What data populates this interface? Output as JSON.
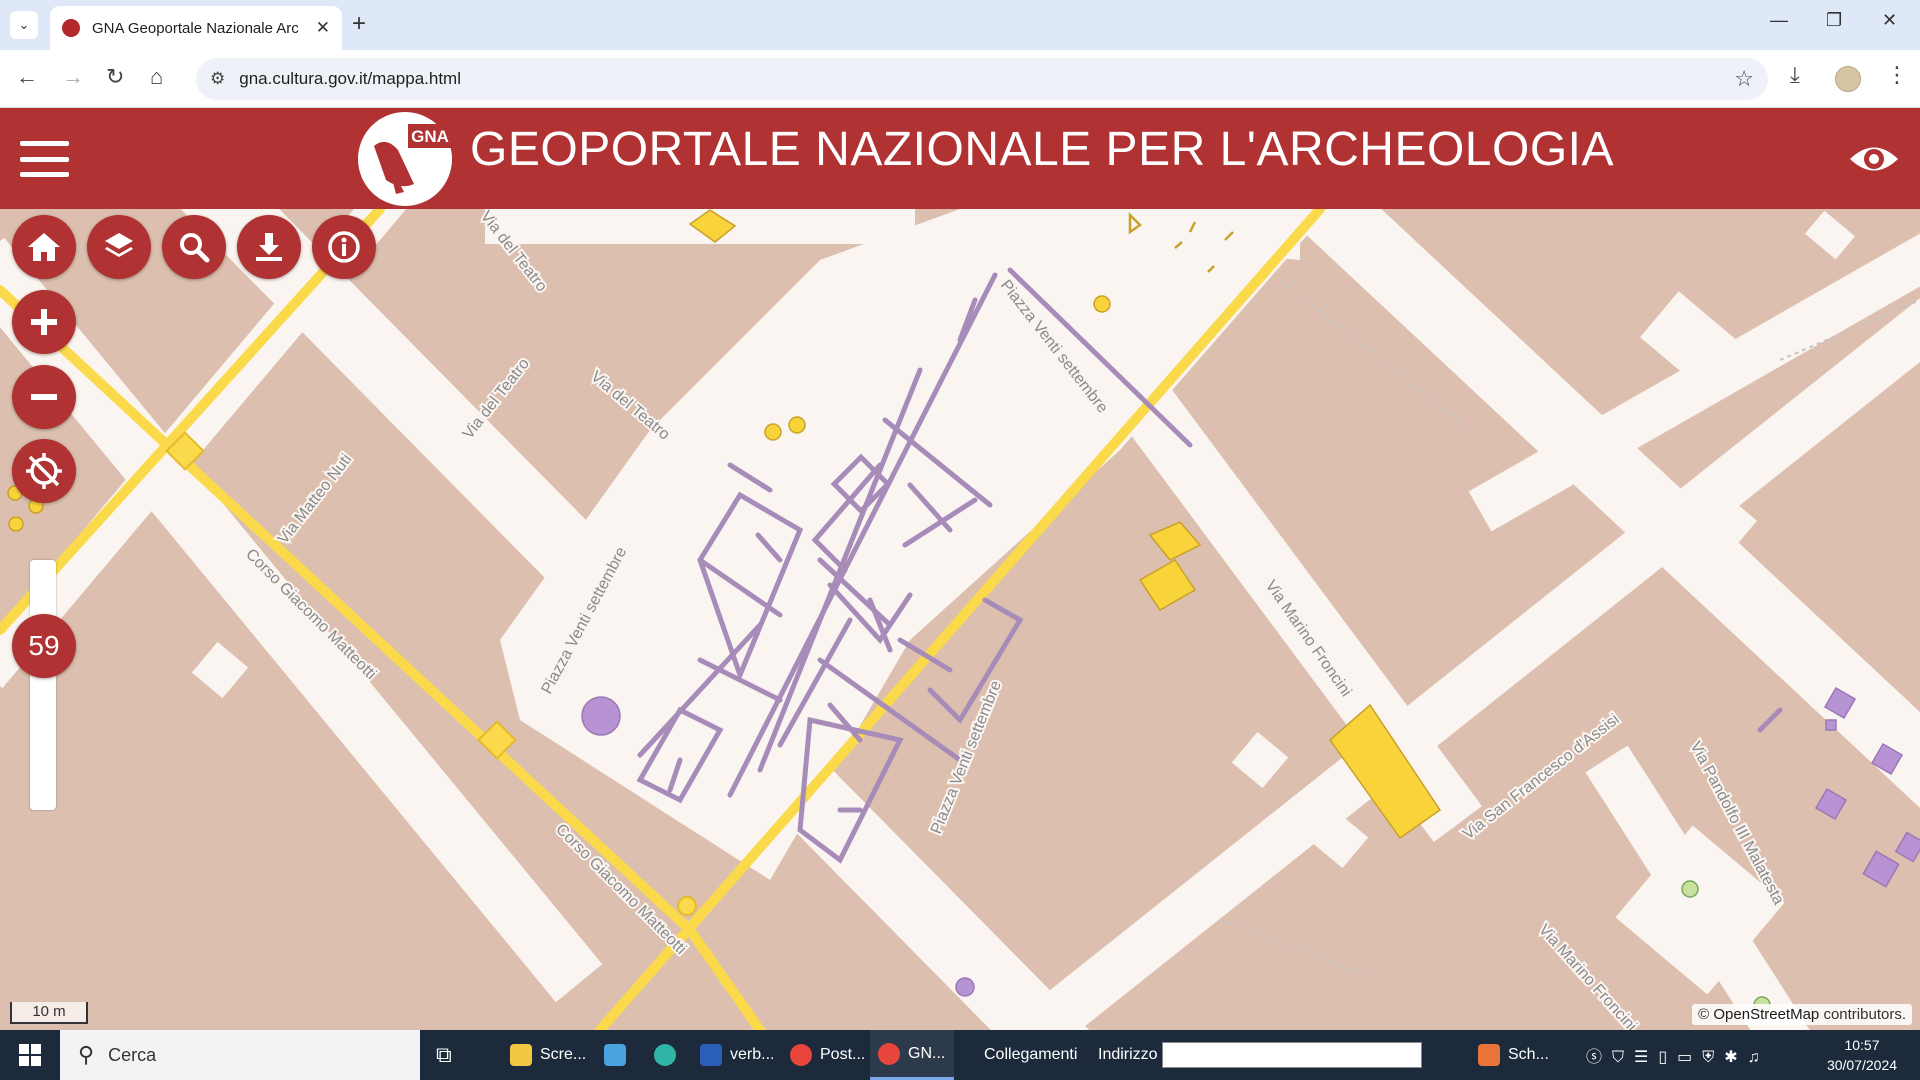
{
  "browser": {
    "tab_title": "GNA Geoportale Nazionale Arc",
    "url": "gna.cultura.gov.it/mappa.html",
    "icons": [
      "tab-list-icon",
      "close-icon",
      "plus-icon",
      "minimize-icon",
      "restore-icon",
      "back-icon",
      "forward-icon",
      "reload-icon",
      "home-icon",
      "site-info-icon",
      "star-icon",
      "download-icon",
      "menu-dots-icon"
    ]
  },
  "app": {
    "logo_text": "GNA",
    "title": "GEOPORTALE NAZIONALE PER L'ARCHEOLOGIA",
    "colors": {
      "header": "#b03233",
      "controls": "#b03233",
      "buildings": "#dcbfae",
      "roads": "#fbf5f1",
      "main_roads": "#fada4a",
      "features_purple": "#a78bb9",
      "features_yellow": "#f8d33a"
    }
  },
  "map": {
    "zoom_level": "59",
    "scale_label": "10 m",
    "attribution_prefix": "©",
    "attribution_link": "OpenStreetMap",
    "attribution_suffix": "contributors.",
    "street_labels": {
      "via_del_teatro_1": "Via del Teatro",
      "via_del_teatro_2": "Via del Teatro",
      "via_del_teatro_3": "Via del Teatro",
      "via_matteo_nuti": "Via Matteo Nuti",
      "corso_matteotti_1": "Corso Giacomo Matteotti",
      "corso_matteotti_2": "Corso Giacomo Matteotti",
      "piazza_venti_1": "Piazza Venti settembre",
      "piazza_venti_2": "Piazza Venti settembre",
      "piazza_venti_3": "Piazza Venti settembre",
      "via_marino_froncini_1": "Via Marino Froncini",
      "via_marino_froncini_2": "Via Marino Froncini",
      "via_san_francesco": "Via San Francesco d'Assisi",
      "via_pandolfo": "Via Pandolfo III Malatesta"
    }
  },
  "controls": [
    "home-button",
    "layers-button",
    "search-button",
    "download-button",
    "info-button",
    "zoom-in-button",
    "zoom-out-button",
    "rotate-reset-button"
  ],
  "taskbar": {
    "search_placeholder": "Cerca",
    "items": [
      "Scre...",
      "verb...",
      "Post...",
      "GN..."
    ],
    "collegamenti": "Collegamenti",
    "indirizzo": "Indirizzo",
    "extra_item": "Sch...",
    "time": "10:57",
    "date": "30/07/2024"
  }
}
